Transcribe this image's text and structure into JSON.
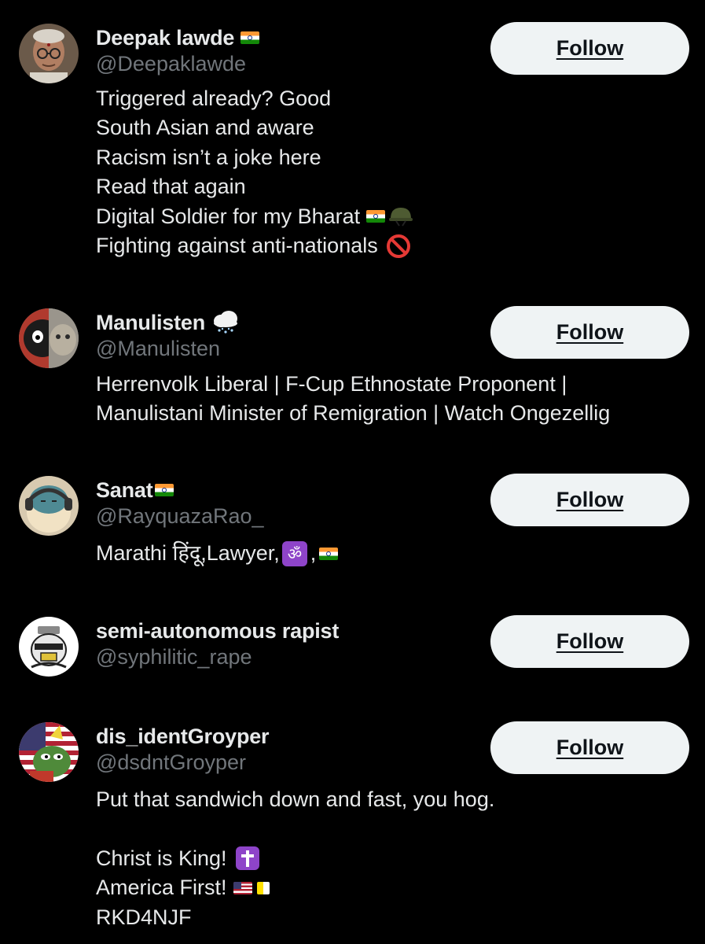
{
  "users": [
    {
      "name": "Deepak lawde",
      "handle": "@Deepaklawde",
      "follow_label": "Follow",
      "bio": [
        "Triggered already? Good",
        "South Asian and aware",
        "Racism isn’t a joke here",
        "Read that again",
        "Digital Soldier for my Bharat",
        "Fighting against anti-nationals"
      ]
    },
    {
      "name": "Manulisten",
      "handle": "@Manulisten",
      "follow_label": "Follow",
      "bio": [
        "Herrenvolk Liberal | F-Cup Ethnostate Proponent |",
        "Manulistani Minister of Remigration | Watch Ongezellig"
      ]
    },
    {
      "name": "Sanat",
      "handle": "@RayquazaRao_",
      "follow_label": "Follow",
      "bio": [
        "Marathi हिंदू,Lawyer,",
        ","
      ]
    },
    {
      "name": "semi-autonomous rapist",
      "handle": "@syphilitic_rape",
      "follow_label": "Follow",
      "bio": []
    },
    {
      "name": "dis_identGroyper",
      "handle": "@dsdntGroyper",
      "follow_label": "Follow",
      "bio": [
        "Put that sandwich down and fast, you hog.",
        "",
        "Christ is King!",
        "America First!",
        "RKD4NJF"
      ]
    }
  ],
  "icons": {
    "india_flag": "flag-india-icon",
    "helmet": "military-helmet-icon",
    "prohibited": "prohibited-icon",
    "snow_cloud": "cloud-snow-icon",
    "om": "om-symbol-icon",
    "cross": "latin-cross-icon",
    "us_flag": "flag-usa-icon",
    "vatican_flag": "flag-vatican-icon"
  },
  "colors": {
    "background": "#000000",
    "text_primary": "#e7e9ea",
    "text_secondary": "#71767b",
    "follow_bg": "#eff3f4",
    "follow_text": "#0f1419"
  }
}
